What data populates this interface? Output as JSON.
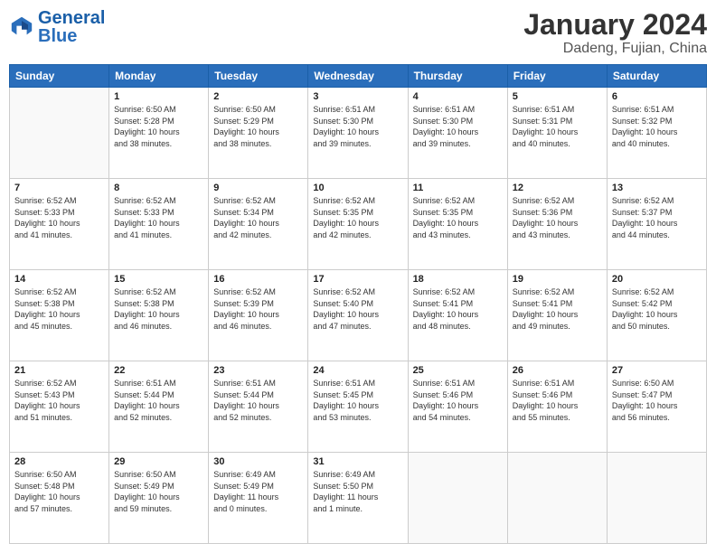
{
  "header": {
    "logo_general": "General",
    "logo_blue": "Blue",
    "month_title": "January 2024",
    "location": "Dadeng, Fujian, China"
  },
  "days_of_week": [
    "Sunday",
    "Monday",
    "Tuesday",
    "Wednesday",
    "Thursday",
    "Friday",
    "Saturday"
  ],
  "weeks": [
    [
      {
        "day": "",
        "info": ""
      },
      {
        "day": "1",
        "info": "Sunrise: 6:50 AM\nSunset: 5:28 PM\nDaylight: 10 hours\nand 38 minutes."
      },
      {
        "day": "2",
        "info": "Sunrise: 6:50 AM\nSunset: 5:29 PM\nDaylight: 10 hours\nand 38 minutes."
      },
      {
        "day": "3",
        "info": "Sunrise: 6:51 AM\nSunset: 5:30 PM\nDaylight: 10 hours\nand 39 minutes."
      },
      {
        "day": "4",
        "info": "Sunrise: 6:51 AM\nSunset: 5:30 PM\nDaylight: 10 hours\nand 39 minutes."
      },
      {
        "day": "5",
        "info": "Sunrise: 6:51 AM\nSunset: 5:31 PM\nDaylight: 10 hours\nand 40 minutes."
      },
      {
        "day": "6",
        "info": "Sunrise: 6:51 AM\nSunset: 5:32 PM\nDaylight: 10 hours\nand 40 minutes."
      }
    ],
    [
      {
        "day": "7",
        "info": "Sunrise: 6:52 AM\nSunset: 5:33 PM\nDaylight: 10 hours\nand 41 minutes."
      },
      {
        "day": "8",
        "info": "Sunrise: 6:52 AM\nSunset: 5:33 PM\nDaylight: 10 hours\nand 41 minutes."
      },
      {
        "day": "9",
        "info": "Sunrise: 6:52 AM\nSunset: 5:34 PM\nDaylight: 10 hours\nand 42 minutes."
      },
      {
        "day": "10",
        "info": "Sunrise: 6:52 AM\nSunset: 5:35 PM\nDaylight: 10 hours\nand 42 minutes."
      },
      {
        "day": "11",
        "info": "Sunrise: 6:52 AM\nSunset: 5:35 PM\nDaylight: 10 hours\nand 43 minutes."
      },
      {
        "day": "12",
        "info": "Sunrise: 6:52 AM\nSunset: 5:36 PM\nDaylight: 10 hours\nand 43 minutes."
      },
      {
        "day": "13",
        "info": "Sunrise: 6:52 AM\nSunset: 5:37 PM\nDaylight: 10 hours\nand 44 minutes."
      }
    ],
    [
      {
        "day": "14",
        "info": "Sunrise: 6:52 AM\nSunset: 5:38 PM\nDaylight: 10 hours\nand 45 minutes."
      },
      {
        "day": "15",
        "info": "Sunrise: 6:52 AM\nSunset: 5:38 PM\nDaylight: 10 hours\nand 46 minutes."
      },
      {
        "day": "16",
        "info": "Sunrise: 6:52 AM\nSunset: 5:39 PM\nDaylight: 10 hours\nand 46 minutes."
      },
      {
        "day": "17",
        "info": "Sunrise: 6:52 AM\nSunset: 5:40 PM\nDaylight: 10 hours\nand 47 minutes."
      },
      {
        "day": "18",
        "info": "Sunrise: 6:52 AM\nSunset: 5:41 PM\nDaylight: 10 hours\nand 48 minutes."
      },
      {
        "day": "19",
        "info": "Sunrise: 6:52 AM\nSunset: 5:41 PM\nDaylight: 10 hours\nand 49 minutes."
      },
      {
        "day": "20",
        "info": "Sunrise: 6:52 AM\nSunset: 5:42 PM\nDaylight: 10 hours\nand 50 minutes."
      }
    ],
    [
      {
        "day": "21",
        "info": "Sunrise: 6:52 AM\nSunset: 5:43 PM\nDaylight: 10 hours\nand 51 minutes."
      },
      {
        "day": "22",
        "info": "Sunrise: 6:51 AM\nSunset: 5:44 PM\nDaylight: 10 hours\nand 52 minutes."
      },
      {
        "day": "23",
        "info": "Sunrise: 6:51 AM\nSunset: 5:44 PM\nDaylight: 10 hours\nand 52 minutes."
      },
      {
        "day": "24",
        "info": "Sunrise: 6:51 AM\nSunset: 5:45 PM\nDaylight: 10 hours\nand 53 minutes."
      },
      {
        "day": "25",
        "info": "Sunrise: 6:51 AM\nSunset: 5:46 PM\nDaylight: 10 hours\nand 54 minutes."
      },
      {
        "day": "26",
        "info": "Sunrise: 6:51 AM\nSunset: 5:46 PM\nDaylight: 10 hours\nand 55 minutes."
      },
      {
        "day": "27",
        "info": "Sunrise: 6:50 AM\nSunset: 5:47 PM\nDaylight: 10 hours\nand 56 minutes."
      }
    ],
    [
      {
        "day": "28",
        "info": "Sunrise: 6:50 AM\nSunset: 5:48 PM\nDaylight: 10 hours\nand 57 minutes."
      },
      {
        "day": "29",
        "info": "Sunrise: 6:50 AM\nSunset: 5:49 PM\nDaylight: 10 hours\nand 59 minutes."
      },
      {
        "day": "30",
        "info": "Sunrise: 6:49 AM\nSunset: 5:49 PM\nDaylight: 11 hours\nand 0 minutes."
      },
      {
        "day": "31",
        "info": "Sunrise: 6:49 AM\nSunset: 5:50 PM\nDaylight: 11 hours\nand 1 minute."
      },
      {
        "day": "",
        "info": ""
      },
      {
        "day": "",
        "info": ""
      },
      {
        "day": "",
        "info": ""
      }
    ]
  ]
}
